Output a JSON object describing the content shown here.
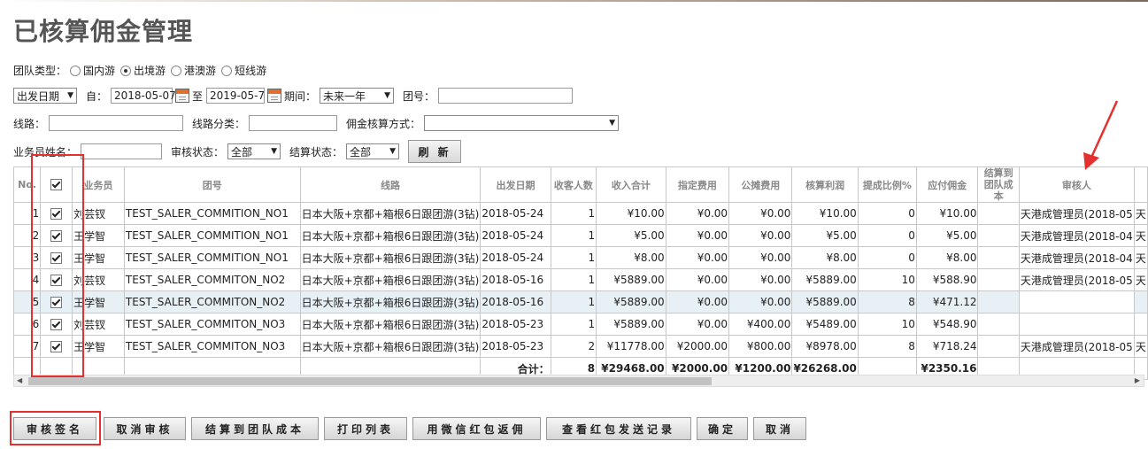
{
  "page": {
    "title": "已核算佣金管理"
  },
  "filters": {
    "team_type_label": "团队类型：",
    "team_types": [
      {
        "label": "国内游",
        "checked": false
      },
      {
        "label": "出境游",
        "checked": true
      },
      {
        "label": "港澳游",
        "checked": false
      },
      {
        "label": "短线游",
        "checked": false
      }
    ],
    "date_type": "出发日期",
    "from_label": "自：",
    "from_date": "2018-05-07",
    "to_label": "至",
    "to_date": "2019-05-7",
    "period_label": "期间：",
    "period_value": "未来一年",
    "team_no_label": "团号：",
    "team_no_value": "",
    "route_label": "线路：",
    "route_value": "",
    "route_cat_label": "线路分类：",
    "route_cat_value": "",
    "commission_method_label": "佣金核算方式：",
    "commission_method_value": "",
    "salesman_label": "业务员姓名：",
    "salesman_value": "",
    "audit_status_label": "审核状态：",
    "audit_status_value": "全部",
    "settle_status_label": "结算状态：",
    "settle_status_value": "全部",
    "refresh_label": "刷 新"
  },
  "table": {
    "headers": [
      "No.",
      "",
      "业务员",
      "团号",
      "线路",
      "出发日期",
      "收客人数",
      "收入合计",
      "指定费用",
      "公摊费用",
      "核算利润",
      "提成比例%",
      "应付佣金",
      "结算到团队成本",
      "审核人",
      ""
    ],
    "rows": [
      [
        "1",
        "",
        "刘芸钗",
        "TEST_SALER_COMMITION_NO1",
        "日本大阪+京都+箱根6日跟团游(3钻)",
        "2018-05-24",
        "1",
        "¥10.00",
        "¥0.00",
        "¥0.00",
        "¥10.00",
        "0",
        "¥10.00",
        "",
        "天港成管理员(2018-05",
        "天"
      ],
      [
        "2",
        "",
        "王学智",
        "TEST_SALER_COMMITION_NO1",
        "日本大阪+京都+箱根6日跟团游(3钻)",
        "2018-05-24",
        "1",
        "¥5.00",
        "¥0.00",
        "¥0.00",
        "¥5.00",
        "0",
        "¥5.00",
        "",
        "天港成管理员(2018-04",
        "天"
      ],
      [
        "3",
        "",
        "王学智",
        "TEST_SALER_COMMITION_NO1",
        "日本大阪+京都+箱根6日跟团游(3钻)",
        "2018-05-24",
        "1",
        "¥8.00",
        "¥0.00",
        "¥0.00",
        "¥8.00",
        "0",
        "¥8.00",
        "",
        "天港成管理员(2018-04",
        "天"
      ],
      [
        "4",
        "",
        "刘芸钗",
        "TEST_SALER_COMMITON_NO2",
        "日本大阪+京都+箱根6日跟团游(3钻)",
        "2018-05-16",
        "1",
        "¥5889.00",
        "¥0.00",
        "¥0.00",
        "¥5889.00",
        "10",
        "¥588.90",
        "",
        "天港成管理员(2018-05",
        "天"
      ],
      [
        "5",
        "",
        "王学智",
        "TEST_SALER_COMMITON_NO2",
        "日本大阪+京都+箱根6日跟团游(3钻)",
        "2018-05-16",
        "1",
        "¥5889.00",
        "¥0.00",
        "¥0.00",
        "¥5889.00",
        "8",
        "¥471.12",
        "",
        "",
        ""
      ],
      [
        "6",
        "",
        "刘芸钗",
        "TEST_SALER_COMMITON_NO3",
        "日本大阪+京都+箱根6日跟团游(3钻)",
        "2018-05-23",
        "1",
        "¥5889.00",
        "¥0.00",
        "¥400.00",
        "¥5489.00",
        "10",
        "¥548.90",
        "",
        "",
        ""
      ],
      [
        "7",
        "",
        "王学智",
        "TEST_SALER_COMMITON_NO3",
        "日本大阪+京都+箱根6日跟团游(3钻)",
        "2018-05-23",
        "2",
        "¥11778.00",
        "¥2000.00",
        "¥800.00",
        "¥8978.00",
        "8",
        "¥718.24",
        "",
        "天港成管理员(2018-05",
        "天"
      ]
    ],
    "totals": {
      "label": "合计：",
      "count": "8",
      "income": "¥29468.00",
      "fee": "¥2000.00",
      "shared": "¥1200.00",
      "profit": "¥26268.00",
      "commission": "¥2350.16"
    }
  },
  "actions": {
    "audit_sign": "审核签名",
    "cancel_audit": "取消审核",
    "settle_team_cost": "结算到团队成本",
    "print_list": "打印列表",
    "wechat_redpacket": "用微信红包返佣",
    "view_redpacket_log": "查看红包发送记录",
    "confirm": "确定",
    "cancel": "取消"
  },
  "colors": {
    "annotation_red": "#e53030",
    "highlight_row": "#e6f0f5"
  }
}
